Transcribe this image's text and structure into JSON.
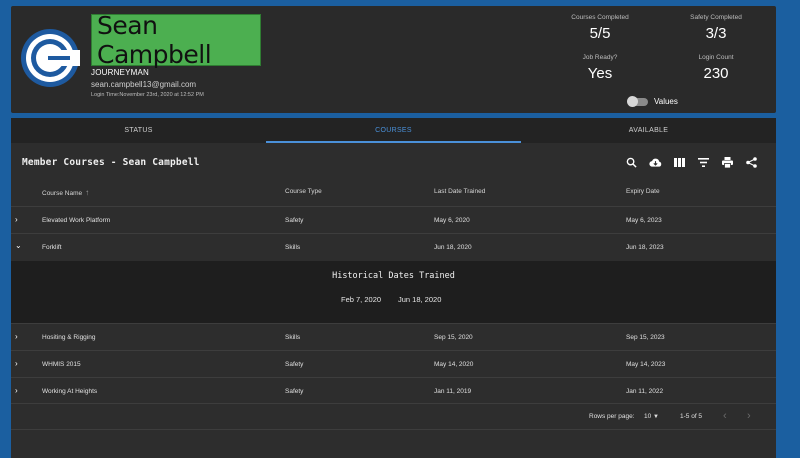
{
  "profile": {
    "name": "Sean Campbell",
    "rank": "JOURNEYMAN",
    "email": "sean.campbell13@gmail.com",
    "login_time": "Login Time:November 23rd, 2020 at 12:52 PM",
    "logo_color": "#1e5aa0"
  },
  "stats": {
    "courses_completed_label": "Courses Completed",
    "courses_completed_value": "5/5",
    "safety_completed_label": "Safety Completed",
    "safety_completed_value": "3/3",
    "job_ready_label": "Job Ready?",
    "job_ready_value": "Yes",
    "login_count_label": "Login Count",
    "login_count_value": "230",
    "values_toggle_label": "Values"
  },
  "tabs": [
    {
      "label": "STATUS",
      "active": false
    },
    {
      "label": "COURSES",
      "active": true
    },
    {
      "label": "AVAILABLE",
      "active": false
    }
  ],
  "table": {
    "title": "Member Courses - Sean Campbell",
    "toolbar_icons": [
      "search-icon",
      "cloud-download-icon",
      "view-column-icon",
      "filter-icon",
      "print-icon",
      "share-icon"
    ],
    "columns": [
      "Course Name",
      "Course Type",
      "Last Date Trained",
      "Expiry Date"
    ],
    "rows": [
      {
        "name": "Elevated Work Platform",
        "type": "Safety",
        "last": "May 6, 2020",
        "expiry": "May 6, 2023",
        "expanded": false
      },
      {
        "name": "Forklift",
        "type": "Skills",
        "last": "Jun 18, 2020",
        "expiry": "Jun 18, 2023",
        "expanded": true
      },
      {
        "name": "Hositing & Rigging",
        "type": "Skills",
        "last": "Sep 15, 2020",
        "expiry": "Sep 15, 2023",
        "expanded": false
      },
      {
        "name": "WHMIS 2015",
        "type": "Safety",
        "last": "May 14, 2020",
        "expiry": "May 14, 2023",
        "expanded": false
      },
      {
        "name": "Working At Heights",
        "type": "Safety",
        "last": "Jan 11, 2019",
        "expiry": "Jan 11, 2022",
        "expanded": false
      }
    ],
    "history": {
      "title": "Historical Dates Trained",
      "dates": [
        "Feb 7, 2020",
        "Jun 18, 2020"
      ]
    },
    "footer": {
      "rows_per_page_label": "Rows per page:",
      "rows_per_page_value": "10",
      "range": "1-5 of 5"
    }
  },
  "colors": {
    "accent": "#4a90d9",
    "name_highlight": "#4caf50",
    "background": "#1b5fa0"
  }
}
